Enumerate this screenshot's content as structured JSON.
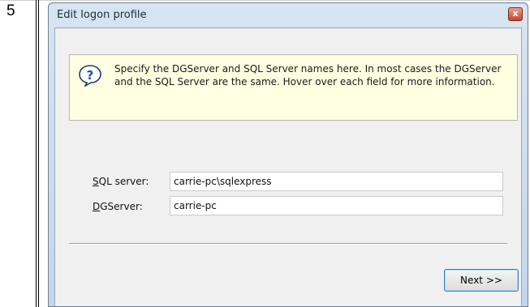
{
  "step": {
    "number": "5"
  },
  "window": {
    "title": "Edit logon profile",
    "close_label": "x"
  },
  "info": {
    "icon": "question-help-icon",
    "text": "Specify the DGServer and SQL Server names here.  In most cases the DGServer and the SQL Server are the same.  Hover over each field for more information."
  },
  "form": {
    "sql_server": {
      "label_accel": "S",
      "label_rest": "QL server:",
      "value": "carrie-pc\\sqlexpress"
    },
    "dg_server": {
      "label_accel": "D",
      "label_rest": "GServer:",
      "value": "carrie-pc"
    }
  },
  "buttons": {
    "next_label": "Next >>"
  },
  "colors": {
    "accent": "#3c7fb1",
    "info_bg": "#ffffe1"
  }
}
